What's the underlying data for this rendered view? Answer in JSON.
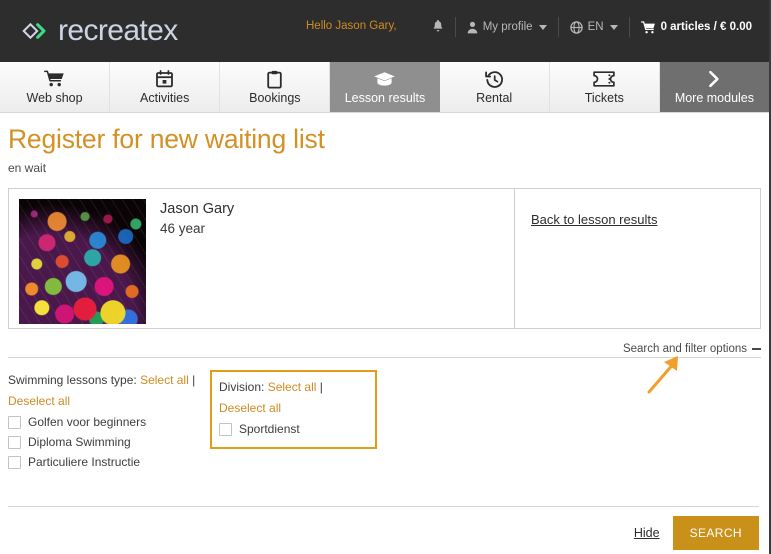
{
  "brand": {
    "name": "recreatex",
    "logo_icon": "diamond-chevron-logo",
    "text_color": "#ccd4e4",
    "accent_color": "#3ddc84",
    "bar_color": "#2d2d2d"
  },
  "topbar": {
    "greeting": "Hello Jason Gary,",
    "greeting_color": "#cf8b22",
    "notifications_icon": "bell-icon",
    "profile_icon": "user-icon",
    "profile_label": "My profile",
    "language_icon": "globe-icon",
    "language_label": "EN",
    "cart_icon": "cart-icon",
    "cart_label": "0 articles / € 0.00"
  },
  "nav": {
    "tabs": [
      {
        "label": "Web shop",
        "icon": "shopping-cart-icon",
        "active": false
      },
      {
        "label": "Activities",
        "icon": "calendar-icon",
        "active": false
      },
      {
        "label": "Bookings",
        "icon": "clipboard-icon",
        "active": false
      },
      {
        "label": "Lesson results",
        "icon": "graduation-cap-icon",
        "active": true
      },
      {
        "label": "Rental",
        "icon": "clock-rewind-icon",
        "active": false
      },
      {
        "label": "Tickets",
        "icon": "ticket-icon",
        "active": false
      },
      {
        "label": "More modules",
        "icon": "chevron-right-icon",
        "active": false
      }
    ],
    "active_bg": "#8f8f8f",
    "more_bg": "#6f6f6f"
  },
  "page": {
    "title": "Register for new waiting list",
    "title_color": "#d39125",
    "subtitle": "en wait"
  },
  "profile_card": {
    "avatar_alt": "colorful-bokeh-avatar",
    "name": "Jason Gary",
    "age": "46 year",
    "back_link": "Back to lesson results"
  },
  "search_filter": {
    "toggle_label": "Search and filter options",
    "toggle_state_icon": "minus-icon",
    "annotation_arrow": "orange-arrow-pointing-up-right",
    "annotation_color": "#f0a02a"
  },
  "filters": {
    "groups": [
      {
        "title": "Swimming lessons type:",
        "select_all": "Select all",
        "separator": "|",
        "deselect_all": "Deselect all",
        "highlighted": false,
        "options": [
          {
            "label": "Golfen voor beginners",
            "checked": false
          },
          {
            "label": "Diploma Swimming",
            "checked": false
          },
          {
            "label": "Particuliere Instructie",
            "checked": false
          }
        ]
      },
      {
        "title": "Division:",
        "select_all": "Select all",
        "separator": "|",
        "deselect_all": "Deselect all",
        "highlighted": true,
        "highlight_color": "#e39c18",
        "options": [
          {
            "label": "Sportdienst",
            "checked": false
          }
        ]
      }
    ]
  },
  "footer": {
    "hide_label": "Hide",
    "search_label": "SEARCH",
    "search_button_color": "#c9911a"
  }
}
